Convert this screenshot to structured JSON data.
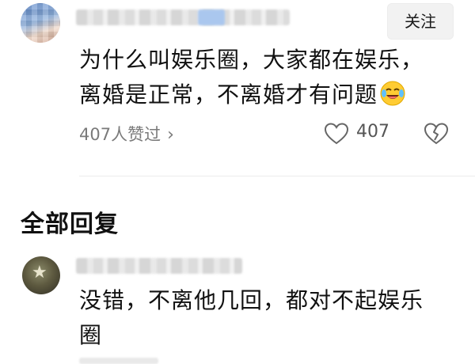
{
  "top_comment": {
    "follow_label": "关注",
    "line1": "为什么叫娱乐圈，大家都在娱乐，",
    "line2": "离婚是正常，不离婚才有问题",
    "emoji_icon": "laughing-crying-emoji-icon",
    "likes_summary": "407人赞过",
    "likes_chevron": "›",
    "like_count": "407"
  },
  "section": {
    "title": "全部回复"
  },
  "reply": {
    "line1": "没错，不离他几回，都对不起娱乐",
    "line2": "圈"
  },
  "colors": {
    "background": "#ffffff",
    "text": "#111111",
    "muted": "#7a7a7a",
    "follow_bg": "#f2f2f2"
  }
}
